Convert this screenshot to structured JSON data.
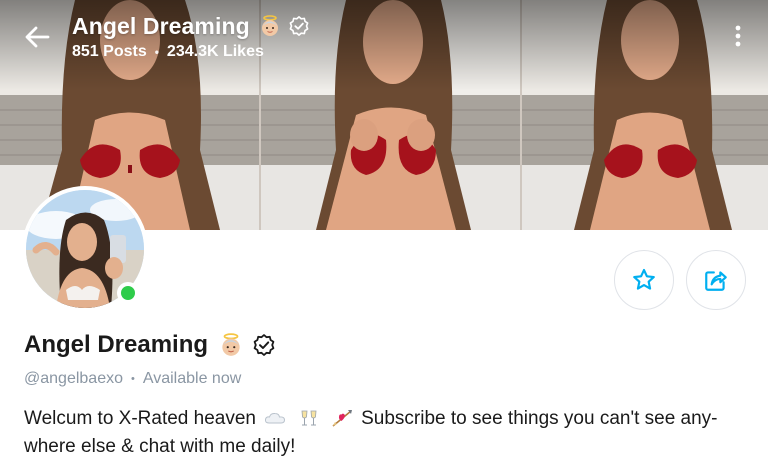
{
  "header": {
    "name": "Angel Dreaming",
    "posts": "851 Posts",
    "likes": "234.3K Likes",
    "separator": "•"
  },
  "profile": {
    "name": "Angel Dreaming",
    "handle": "@angelbaexo",
    "separator": "•",
    "status": "Available now",
    "online": true,
    "bio_part1": "Welcum to X-Rated heaven",
    "bio_part2": "Subscribe to see things you can't see any-",
    "bio_line2": "where else & chat with me daily!"
  },
  "icons": {
    "back": "arrow-left-icon",
    "more": "vertical-dots-icon",
    "verified": "verified-badge-icon",
    "emoji": "baby-angel-emoji",
    "favorite": "star-icon",
    "share": "share-icon",
    "cloud": "cloud-emoji",
    "champagne": "clinking-glasses-emoji",
    "cupid": "heart-arrow-emoji"
  },
  "colors": {
    "accent": "#00aff0",
    "online": "#2ecc4a",
    "muted_text": "#8a96a3",
    "text": "#1a1a1a"
  }
}
